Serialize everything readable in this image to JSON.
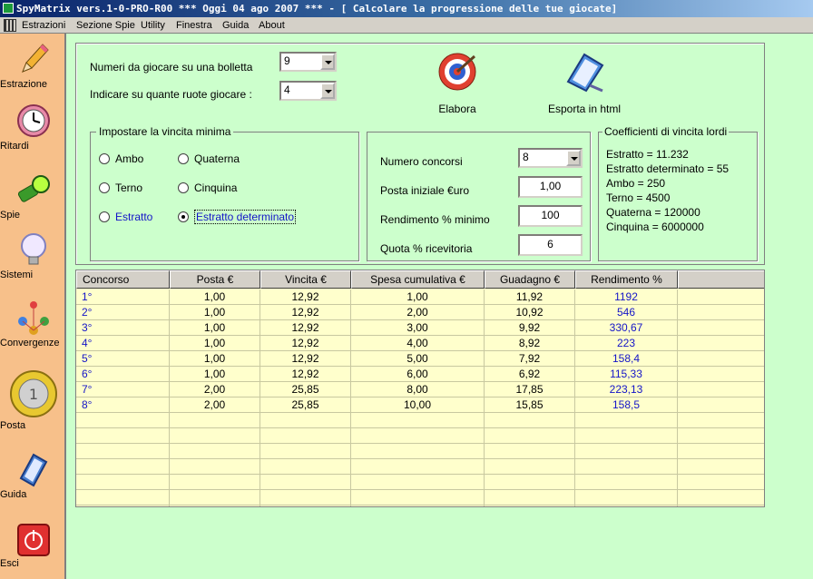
{
  "window": {
    "title": "SpyMatrix vers.1-0-PRO-R00  ***  Oggi 04 ago 2007  ***   - [ Calcolare la progressione delle tue giocate]"
  },
  "menu": [
    "Estrazioni",
    "Sezione Spie",
    "Utility",
    "Finestra",
    "Guida",
    "About"
  ],
  "sidebar": [
    "Estrazione",
    "Ritardi",
    "Spie",
    "Sistemi",
    "Convergenze",
    "Posta",
    "Guida",
    "Esci"
  ],
  "form": {
    "numeri_label": "Numeri da giocare su una bolletta",
    "numeri_value": "9",
    "ruote_label": "Indicare su quante ruote giocare :",
    "ruote_value": "4"
  },
  "toolbar": {
    "elabora": "Elabora",
    "esporta": "Esporta in html"
  },
  "vincita": {
    "caption": "Impostare la vincita minima",
    "options": [
      "Ambo",
      "Terno",
      "Estratto",
      "Quaterna",
      "Cinquina",
      "Estratto determinato"
    ],
    "selected": "Estratto determinato"
  },
  "params": {
    "concorsi_label": "Numero concorsi",
    "concorsi_value": "8",
    "posta_label": "Posta iniziale €uro",
    "posta_value": "1,00",
    "rend_label": "Rendimento % minimo",
    "rend_value": "100",
    "quota_label": "Quota % ricevitoria",
    "quota_value": "6"
  },
  "coefficienti": {
    "caption": "Coefficienti di vincita lordi",
    "lines": [
      "Estratto =  11.232",
      "Estratto determinato =  55",
      "Ambo =  250",
      "Terno =  4500",
      "Quaterna =  120000",
      "Cinquina =  6000000"
    ]
  },
  "table": {
    "headers": [
      "Concorso",
      "Posta €",
      "Vincita €",
      "Spesa cumulativa €",
      "Guadagno €",
      "Rendimento %"
    ],
    "rows": [
      [
        "1°",
        "1,00",
        "12,92",
        "1,00",
        "11,92",
        "1192"
      ],
      [
        "2°",
        "1,00",
        "12,92",
        "2,00",
        "10,92",
        "546"
      ],
      [
        "3°",
        "1,00",
        "12,92",
        "3,00",
        "9,92",
        "330,67"
      ],
      [
        "4°",
        "1,00",
        "12,92",
        "4,00",
        "8,92",
        "223"
      ],
      [
        "5°",
        "1,00",
        "12,92",
        "5,00",
        "7,92",
        "158,4"
      ],
      [
        "6°",
        "1,00",
        "12,92",
        "6,00",
        "6,92",
        "115,33"
      ],
      [
        "7°",
        "2,00",
        "25,85",
        "8,00",
        "17,85",
        "223,13"
      ],
      [
        "8°",
        "2,00",
        "25,85",
        "10,00",
        "15,85",
        "158,5"
      ]
    ],
    "empty_rows": 7
  }
}
